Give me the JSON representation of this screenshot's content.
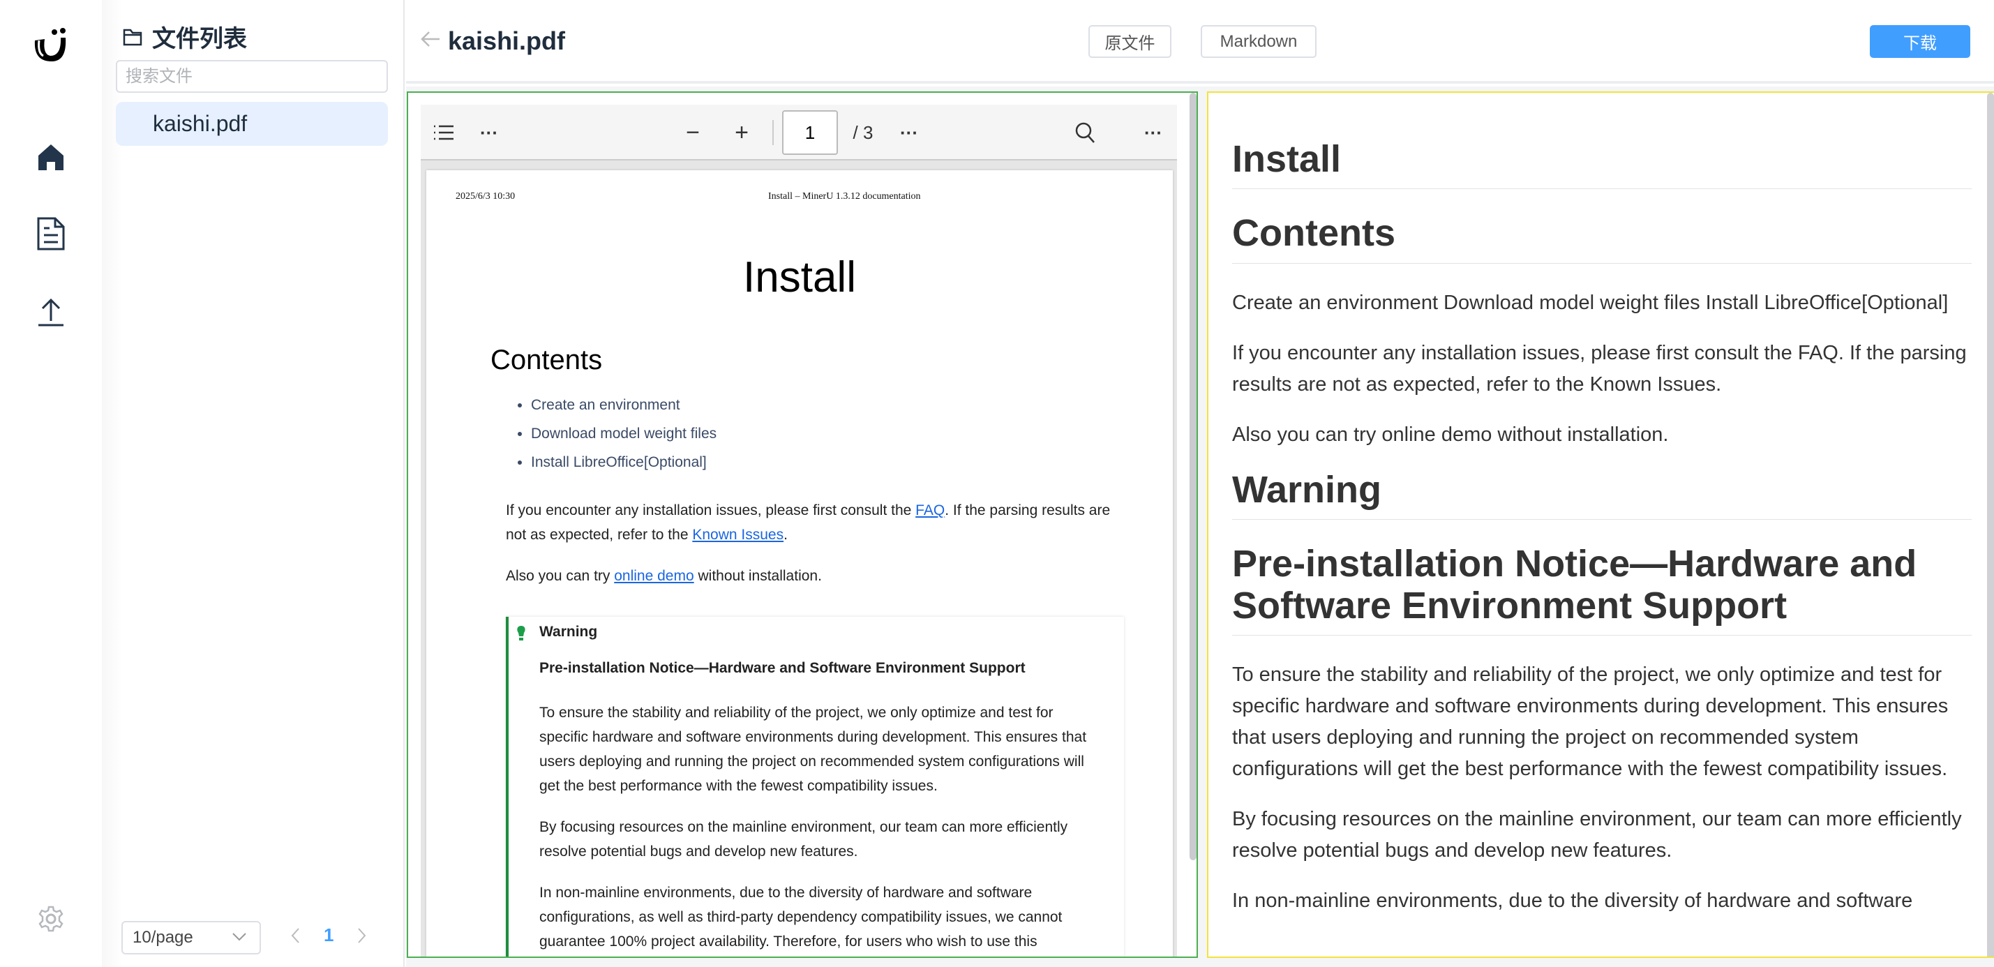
{
  "sidebar": {
    "icons": [
      "logo-icon",
      "home-icon",
      "document-icon",
      "upload-icon",
      "settings-icon"
    ]
  },
  "file_panel": {
    "title": "文件列表",
    "search_placeholder": "搜索文件",
    "files": [
      {
        "name": "kaishi.pdf",
        "selected": true
      }
    ],
    "page_size": "10/page",
    "current_page": "1"
  },
  "header": {
    "title": "kaishi.pdf",
    "original_label": "原文件",
    "markdown_label": "Markdown",
    "download_label": "下载",
    "accent": "#409eff"
  },
  "pdf_viewer": {
    "page_input": "1",
    "page_total": "/ 3",
    "page": {
      "header_left": "2025/6/3 10:30",
      "header_center": "Install – MinerU 1.3.12 documentation",
      "title": "Install",
      "contents_heading": "Contents",
      "contents": [
        "Create an environment",
        "Download model weight files",
        "Install LibreOffice[Optional]"
      ],
      "p1_a": "If you encounter any installation issues, please first consult the ",
      "p1_link1": "FAQ",
      "p1_b": ". If the parsing results are not as expected, refer to the ",
      "p1_link2": "Known Issues",
      "p1_c": ".",
      "p2_a": "Also you can try ",
      "p2_link": "online demo",
      "p2_b": " without installation.",
      "warning_title": "Warning",
      "warning_subtitle": "Pre-installation Notice—Hardware and Software Environment Support",
      "warning_paras": [
        "To ensure the stability and reliability of the project, we only optimize and test for specific hardware and software environments during development. This ensures that users deploying and running the project on recommended system configurations will get the best performance with the fewest compatibility issues.",
        "By focusing resources on the mainline environment, our team can more efficiently resolve potential bugs and develop new features.",
        "In non-mainline environments, due to the diversity of hardware and software configurations, as well as third-party dependency compatibility issues, we cannot guarantee 100% project availability. Therefore, for users who wish to use this"
      ]
    }
  },
  "markdown": {
    "h_install": "Install",
    "h_contents": "Contents",
    "p_contents": "Create an environment Download model weight files Install LibreOffice[Optional]",
    "p_issues": "If you encounter any installation issues, please first consult the FAQ. If the parsing results are not as expected, refer to the Known Issues.",
    "p_demo": "Also you can try online demo without installation.",
    "h_warning": "Warning",
    "h_notice": "Pre-installation Notice—Hardware and Software Environment Support",
    "p_ensure": "To ensure the stability and reliability of the project, we only optimize and test for specific hardware and software environments during development. This ensures that users deploying and running the project on recommended system configurations will get the best performance with the fewest compatibility issues.",
    "p_focus": "By focusing resources on the mainline environment, our team can more efficiently resolve potential bugs and develop new features.",
    "p_nonmain": "In non-mainline environments, due to the diversity of hardware and software"
  }
}
